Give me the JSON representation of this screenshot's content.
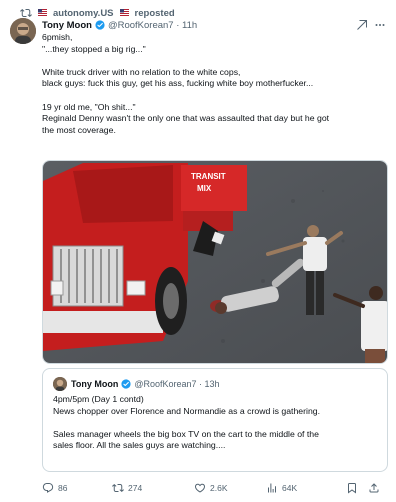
{
  "repost": {
    "icon": "repost-icon",
    "account": "autonomy.US",
    "label": "reposted"
  },
  "author": {
    "name": "Tony Moon",
    "handle": "@RoofKorean7",
    "time": "11h",
    "avatar": "avatar"
  },
  "tweet": {
    "lines": [
      "6pmish,",
      "\"...they stopped a big rig...\"",
      "",
      "White truck driver with no relation to the white cops,",
      "black guys: fuck this guy, get his ass, fucking white boy motherfucker...",
      "",
      "19 yr old me, \"Oh shit...\"",
      "Reginald Denny wasn't the only one that was assaulted that day but he got",
      "the most coverage."
    ]
  },
  "media": {
    "kind": "photo",
    "truck_lettering": [
      "TRANSIT",
      "MIX"
    ]
  },
  "quote": {
    "name": "Tony Moon",
    "handle": "@RoofKorean7",
    "time": "13h",
    "lines": [
      "4pm/5pm (Day 1 contd)",
      "News chopper over Florence and Normandie as a crowd is gathering.",
      "",
      "Sales manager wheels the big box TV on the cart to the middle of the",
      "sales floor. All the sales guys are watching...."
    ]
  },
  "actions": {
    "replies": "86",
    "reposts": "274",
    "likes": "2.6K",
    "views": "64K",
    "icons": [
      "reply-icon",
      "repost-icon",
      "like-icon",
      "views-icon",
      "bookmark-icon",
      "share-icon"
    ]
  },
  "colors": {
    "accent": "#1d9bf0",
    "muted": "#536471",
    "border": "#cfd9de",
    "truck": "#d62828"
  }
}
